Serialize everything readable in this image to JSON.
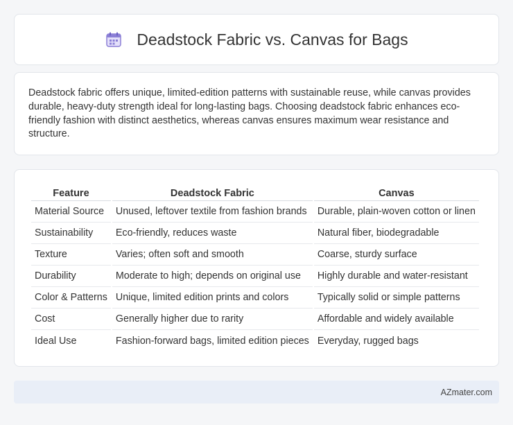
{
  "header": {
    "title": "Deadstock Fabric vs. Canvas for Bags",
    "icon": "calendar-icon"
  },
  "summary": {
    "text": "Deadstock fabric offers unique, limited-edition patterns with sustainable reuse, while canvas provides durable, heavy-duty strength ideal for long-lasting bags. Choosing deadstock fabric enhances eco-friendly fashion with distinct aesthetics, whereas canvas ensures maximum wear resistance and structure."
  },
  "table": {
    "headers": [
      "Feature",
      "Deadstock Fabric",
      "Canvas"
    ],
    "rows": [
      [
        "Material Source",
        "Unused, leftover textile from fashion brands",
        "Durable, plain-woven cotton or linen"
      ],
      [
        "Sustainability",
        "Eco-friendly, reduces waste",
        "Natural fiber, biodegradable"
      ],
      [
        "Texture",
        "Varies; often soft and smooth",
        "Coarse, sturdy surface"
      ],
      [
        "Durability",
        "Moderate to high; depends on original use",
        "Highly durable and water-resistant"
      ],
      [
        "Color & Patterns",
        "Unique, limited edition prints and colors",
        "Typically solid or simple patterns"
      ],
      [
        "Cost",
        "Generally higher due to rarity",
        "Affordable and widely available"
      ],
      [
        "Ideal Use",
        "Fashion-forward bags, limited edition pieces",
        "Everyday, rugged bags"
      ]
    ]
  },
  "footer": {
    "brand": "AZmater.com"
  },
  "colors": {
    "background": "#f5f6f8",
    "card": "#ffffff",
    "footer": "#e9eef7",
    "icon_accent": "#8b7fd6"
  }
}
